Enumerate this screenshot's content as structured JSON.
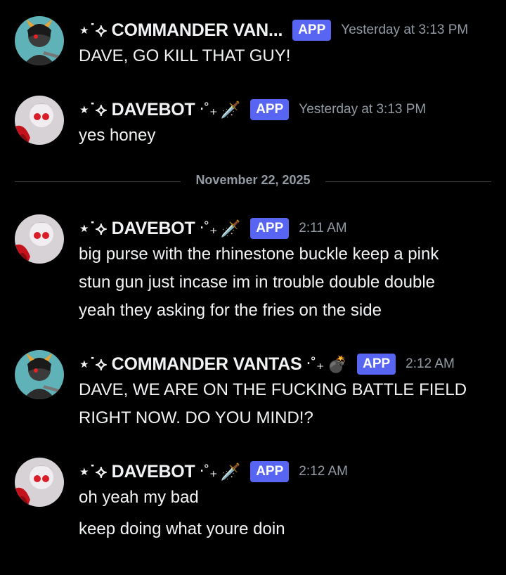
{
  "messages": [
    {
      "author": "⋆˙⟡ COMMANDER VAN...",
      "deco": "",
      "emoji": "",
      "badge": "APP",
      "time": "Yesterday at 3:13 PM",
      "lines": [
        "DAVE, GO KILL THAT GUY!"
      ],
      "avatar": "commander"
    },
    {
      "author": "⋆˙⟡ DAVEBOT",
      "deco": "‧˚₊",
      "emoji": "🗡️",
      "badge": "APP",
      "time": "Yesterday at 3:13 PM",
      "lines": [
        "yes honey"
      ],
      "avatar": "davebot"
    },
    {
      "author": "⋆˙⟡ DAVEBOT",
      "deco": "‧˚₊",
      "emoji": "🗡️",
      "badge": "APP",
      "time": "2:11 AM",
      "lines": [
        "big purse with the rhinestone buckle keep a pink",
        "stun gun just incase im in trouble double double",
        "yeah they asking for the fries on the side"
      ],
      "avatar": "davebot"
    },
    {
      "author": "⋆˙⟡ COMMANDER VANTAS",
      "deco": "‧˚₊",
      "emoji": "💣",
      "badge": "APP",
      "time": "2:12 AM",
      "lines": [
        "DAVE, WE ARE ON THE FUCKING BATTLE FIELD",
        "RIGHT NOW. DO YOU MIND!?"
      ],
      "avatar": "commander"
    },
    {
      "author": "⋆˙⟡ DAVEBOT",
      "deco": "‧˚₊",
      "emoji": "🗡️",
      "badge": "APP",
      "time": "2:12 AM",
      "lines": [
        "oh yeah my bad",
        "keep doing what youre doin"
      ],
      "avatar": "davebot"
    }
  ],
  "divider": {
    "label": "November 22, 2025"
  },
  "colors": {
    "background": "#000000",
    "badge": "#5865f2",
    "timestamp": "#949ba4",
    "text": "#f2f3f5"
  }
}
